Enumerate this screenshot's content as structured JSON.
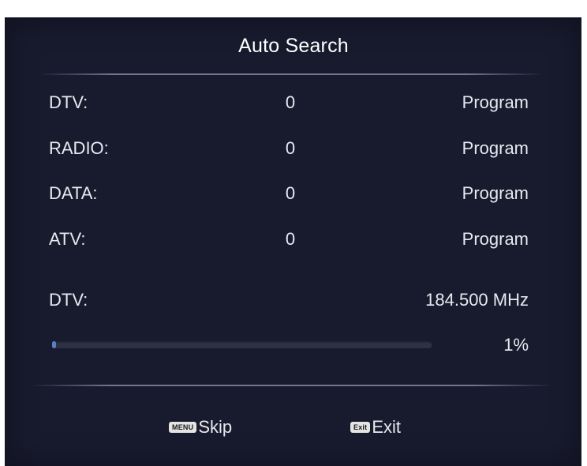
{
  "title": "Auto Search",
  "channels": [
    {
      "label": "DTV:",
      "count": "0",
      "unit": "Program"
    },
    {
      "label": "RADIO:",
      "count": "0",
      "unit": "Program"
    },
    {
      "label": "DATA:",
      "count": "0",
      "unit": "Program"
    },
    {
      "label": "ATV:",
      "count": "0",
      "unit": "Program"
    }
  ],
  "scan": {
    "label": "DTV:",
    "frequency": "184.500 MHz"
  },
  "progress": {
    "value": 1,
    "text": "1%"
  },
  "footer": {
    "skip": {
      "key": "MENU",
      "label": "Skip",
      "icon": "menu-key-icon"
    },
    "exit": {
      "key": "Exit",
      "label": "Exit",
      "icon": "exit-key-icon"
    }
  },
  "colors": {
    "panel_bg": "#181a2e",
    "text": "#e8e9ef",
    "progress_fill": "#5c7fc4",
    "progress_track": "#2f3246"
  }
}
